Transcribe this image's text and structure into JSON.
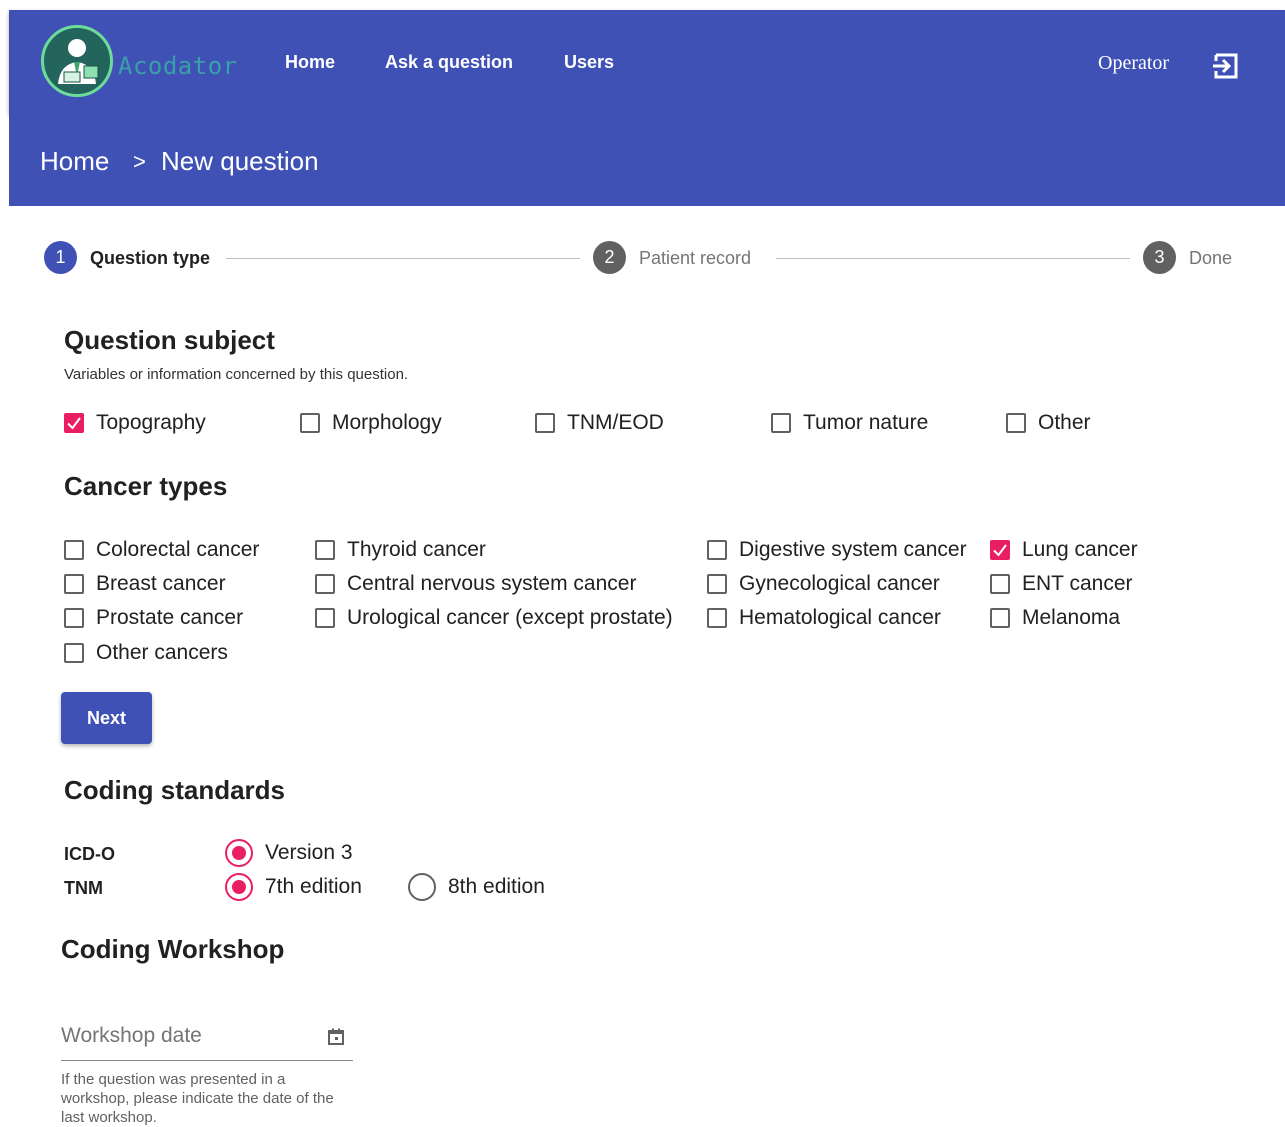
{
  "header": {
    "logo_text": "Acodator",
    "nav": [
      "Home",
      "Ask a question",
      "Users"
    ],
    "user_name": "Operator",
    "logout_icon": "logout-icon"
  },
  "breadcrumb": {
    "home": "Home",
    "separator": ">",
    "current": "New question"
  },
  "stepper": [
    {
      "number": "1",
      "label": "Question type",
      "active": true
    },
    {
      "number": "2",
      "label": "Patient record",
      "active": false
    },
    {
      "number": "3",
      "label": "Done",
      "active": false
    }
  ],
  "question_subject": {
    "title": "Question subject",
    "hint": "Variables or information concerned by this question.",
    "options": [
      {
        "label": "Topography",
        "checked": true
      },
      {
        "label": "Morphology",
        "checked": false
      },
      {
        "label": "TNM/EOD",
        "checked": false
      },
      {
        "label": "Tumor nature",
        "checked": false
      },
      {
        "label": "Other",
        "checked": false
      }
    ]
  },
  "cancer_types": {
    "title": "Cancer types",
    "options": [
      {
        "label": "Colorectal cancer",
        "checked": false
      },
      {
        "label": "Thyroid cancer",
        "checked": false
      },
      {
        "label": "Digestive system cancer",
        "checked": false
      },
      {
        "label": "Lung cancer",
        "checked": true
      },
      {
        "label": "Breast cancer",
        "checked": false
      },
      {
        "label": "Central nervous system cancer",
        "checked": false
      },
      {
        "label": "Gynecological cancer",
        "checked": false
      },
      {
        "label": "ENT cancer",
        "checked": false
      },
      {
        "label": "Prostate cancer",
        "checked": false
      },
      {
        "label": "Urological cancer (except prostate)",
        "checked": false
      },
      {
        "label": "Hematological cancer",
        "checked": false
      },
      {
        "label": "Melanoma",
        "checked": false
      },
      {
        "label": "Other cancers",
        "checked": false
      }
    ]
  },
  "next_button": "Next",
  "coding_standards": {
    "title": "Coding standards",
    "icdo": {
      "label": "ICD-O",
      "options": [
        {
          "label": "Version 3",
          "selected": true
        }
      ]
    },
    "tnm": {
      "label": "TNM",
      "options": [
        {
          "label": "7th edition",
          "selected": true
        },
        {
          "label": "8th edition",
          "selected": false
        }
      ]
    }
  },
  "coding_workshop": {
    "title": "Coding Workshop",
    "date_placeholder": "Workshop date",
    "date_value": "",
    "help": "If the question was presented in a workshop, please indicate the date of the last workshop."
  },
  "colors": {
    "primary": "#3f51b5",
    "accent": "#e91e63",
    "step_inactive": "#616161"
  }
}
